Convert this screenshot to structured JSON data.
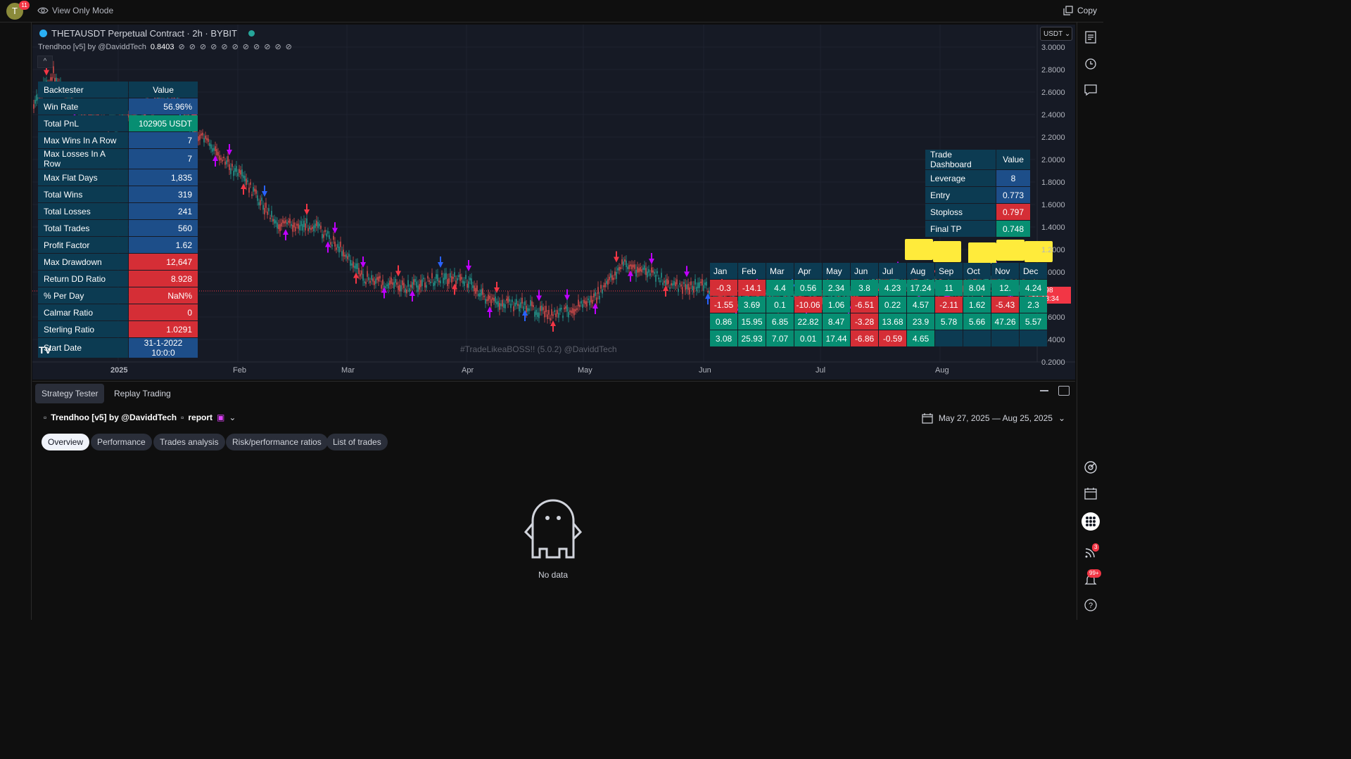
{
  "topbar": {
    "avatar_letter": "T",
    "notification_count": "11",
    "view_mode_label": "View Only Mode",
    "copy_label": "Copy"
  },
  "chart": {
    "symbol_title": "THETAUSDT Perpetual Contract · 2h · BYBIT",
    "indicator_name": "Trendhoo [v5] by @DaviddTech",
    "indicator_value": "0.8403",
    "currency": "USDT",
    "collapse_glyph": "^",
    "price_scale": [
      "3.0000",
      "2.8000",
      "2.6000",
      "2.4000",
      "2.2000",
      "2.0000",
      "1.8000",
      "1.6000",
      "1.4000",
      "1.2000",
      "1.0000",
      "0.6000",
      "0.4000",
      "0.2000"
    ],
    "time_scale": [
      "2025",
      "Feb",
      "Mar",
      "Apr",
      "May",
      "Jun",
      "Jul",
      "Aug"
    ],
    "last_price": "0.8298",
    "countdown": "01:18:34",
    "watermark": "#TradeLikeaBOSS!! (5.0.2) @DaviddTech",
    "logo_text": "TV"
  },
  "backtester": {
    "header_key": "Backtester",
    "header_value": "Value",
    "rows": [
      {
        "k": "Win Rate",
        "v": "56.96%",
        "c": ""
      },
      {
        "k": "Total PnL",
        "v": "102905 USDT",
        "c": "green"
      },
      {
        "k": "Max Wins In A Row",
        "v": "7",
        "c": ""
      },
      {
        "k": "Max Losses In A Row",
        "v": "7",
        "c": ""
      },
      {
        "k": "Max Flat Days",
        "v": "1,835",
        "c": ""
      },
      {
        "k": "Total Wins",
        "v": "319",
        "c": ""
      },
      {
        "k": "Total Losses",
        "v": "241",
        "c": ""
      },
      {
        "k": "Total Trades",
        "v": "560",
        "c": ""
      },
      {
        "k": "Profit Factor",
        "v": "1.62",
        "c": ""
      },
      {
        "k": "Max Drawdown",
        "v": "12,647",
        "c": "red"
      },
      {
        "k": "Return DD Ratio",
        "v": "8.928",
        "c": "red"
      },
      {
        "k": "% Per Day",
        "v": "NaN%",
        "c": "red"
      },
      {
        "k": "Calmar Ratio",
        "v": "0",
        "c": "red"
      },
      {
        "k": "Sterling Ratio",
        "v": "1.0291",
        "c": "red"
      },
      {
        "k": "Start Date",
        "v": "31-1-2022 10:0:0",
        "c": ""
      }
    ]
  },
  "trade_dashboard": {
    "header_key": "Trade Dashboard",
    "header_value": "Value",
    "rows": [
      {
        "k": "Leverage",
        "v": "8",
        "c": ""
      },
      {
        "k": "Entry",
        "v": "0.773",
        "c": ""
      },
      {
        "k": "Stoploss",
        "v": "0.797",
        "c": "red"
      },
      {
        "k": "Final TP",
        "v": "0.748",
        "c": "green"
      }
    ]
  },
  "monthly": {
    "months": [
      "Jan",
      "Feb",
      "Mar",
      "Apr",
      "May",
      "Jun",
      "Jul",
      "Aug",
      "Sep",
      "Oct",
      "Nov",
      "Dec"
    ],
    "rows": [
      [
        {
          "v": "-0.3",
          "c": "r"
        },
        {
          "v": "-14.1",
          "c": "r"
        },
        {
          "v": "4.4",
          "c": "g"
        },
        {
          "v": "0.56",
          "c": "g"
        },
        {
          "v": "2.34",
          "c": "g"
        },
        {
          "v": "3.8",
          "c": "g"
        },
        {
          "v": "4.23",
          "c": "g"
        },
        {
          "v": "17.24",
          "c": "g"
        },
        {
          "v": "11",
          "c": "g"
        },
        {
          "v": "8.04",
          "c": "g"
        },
        {
          "v": "12.",
          "c": "g"
        },
        {
          "v": "4.24",
          "c": "g"
        }
      ],
      [
        {
          "v": "-1.55",
          "c": "r"
        },
        {
          "v": "3.69",
          "c": "g"
        },
        {
          "v": "0.1",
          "c": "g"
        },
        {
          "v": "-10.06",
          "c": "r"
        },
        {
          "v": "1.06",
          "c": "g"
        },
        {
          "v": "-6.51",
          "c": "r"
        },
        {
          "v": "0.22",
          "c": "g"
        },
        {
          "v": "4.57",
          "c": "g"
        },
        {
          "v": "-2.11",
          "c": "r"
        },
        {
          "v": "1.62",
          "c": "g"
        },
        {
          "v": "-5.43",
          "c": "r"
        },
        {
          "v": "2.3",
          "c": "g"
        }
      ],
      [
        {
          "v": "0.86",
          "c": "g"
        },
        {
          "v": "15.95",
          "c": "g"
        },
        {
          "v": "6.85",
          "c": "g"
        },
        {
          "v": "22.82",
          "c": "g"
        },
        {
          "v": "8.47",
          "c": "g"
        },
        {
          "v": "-3.28",
          "c": "r"
        },
        {
          "v": "13.68",
          "c": "g"
        },
        {
          "v": "23.9",
          "c": "g"
        },
        {
          "v": "5.78",
          "c": "g"
        },
        {
          "v": "5.66",
          "c": "g"
        },
        {
          "v": "47.26",
          "c": "g"
        },
        {
          "v": "5.57",
          "c": "g"
        }
      ],
      [
        {
          "v": "3.08",
          "c": "g"
        },
        {
          "v": "25.93",
          "c": "g"
        },
        {
          "v": "7.07",
          "c": "g"
        },
        {
          "v": "0.01",
          "c": "g"
        },
        {
          "v": "17.44",
          "c": "g"
        },
        {
          "v": "-6.86",
          "c": "r"
        },
        {
          "v": "-0.59",
          "c": "r"
        },
        {
          "v": "4.65",
          "c": "g"
        },
        {
          "v": "",
          "c": "b"
        },
        {
          "v": "",
          "c": "b"
        },
        {
          "v": "",
          "c": "b"
        },
        {
          "v": "",
          "c": "b"
        }
      ]
    ]
  },
  "right_toolbar": {
    "icons": [
      "watchlist-icon",
      "alarm-clock-icon",
      "chat-icon",
      "target-icon",
      "calendar-icon",
      "apps-grid-icon",
      "broadcast-icon",
      "bell-icon",
      "help-icon"
    ],
    "broadcast_count": "3",
    "notification_count": "99+"
  },
  "panel": {
    "tabs": [
      "Strategy Tester",
      "Replay Trading"
    ],
    "report_indicator": "Trendhoo [v5] by @DaviddTech",
    "report_label": "report",
    "date_range": "May 27, 2025 — Aug 25, 2025",
    "subtabs": [
      "Overview",
      "Performance",
      "Trades analysis",
      "Risk/performance ratios",
      "List of trades"
    ],
    "empty_message": "No data"
  },
  "colors": {
    "background": "#0f0f0f",
    "chart_bg": "#161a25",
    "table_key_bg": "#0c3b52",
    "table_value_bg": "#1d4e89",
    "red": "#d52e36",
    "green": "#078e72",
    "signal_magenta": "#c000ff"
  }
}
